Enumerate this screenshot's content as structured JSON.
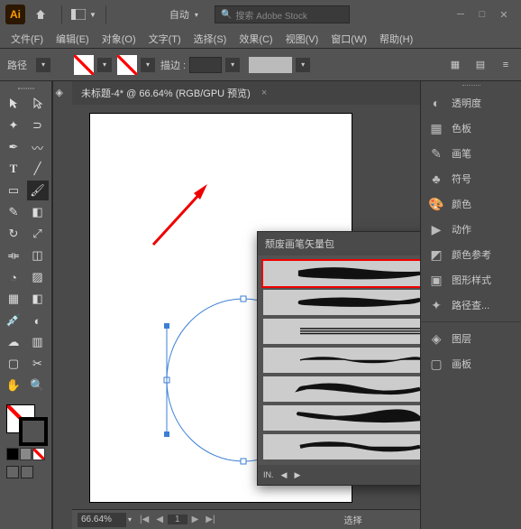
{
  "titlebar": {
    "logo": "Ai",
    "auto": "自动",
    "search_placeholder": "搜索 Adobe Stock"
  },
  "menu": [
    "文件(F)",
    "编辑(E)",
    "对象(O)",
    "文字(T)",
    "选择(S)",
    "效果(C)",
    "视图(V)",
    "窗口(W)",
    "帮助(H)"
  ],
  "ctrl": {
    "label": "路径",
    "stroke_label": "描边 :"
  },
  "doc": {
    "title": "未标题-4* @ 66.64% (RGB/GPU 预览)"
  },
  "panel": {
    "title": "颓废画笔矢量包",
    "brushes": [
      "b1",
      "b2",
      "b3",
      "b4",
      "b5",
      "b6",
      "b7"
    ]
  },
  "rpanel": {
    "items": [
      {
        "icon": "◐",
        "label": "透明度"
      },
      {
        "icon": "▦",
        "label": "色板"
      },
      {
        "icon": "✎",
        "label": "画笔"
      },
      {
        "icon": "♣",
        "label": "符号"
      },
      {
        "icon": "🎨",
        "label": "颜色"
      },
      {
        "icon": "▶",
        "label": "动作"
      },
      {
        "icon": "◩",
        "label": "颜色参考"
      },
      {
        "icon": "▣",
        "label": "图形样式"
      },
      {
        "icon": "✦",
        "label": "路径查..."
      }
    ],
    "items2": [
      {
        "icon": "◈",
        "label": "图层"
      },
      {
        "icon": "▢",
        "label": "画板"
      }
    ]
  },
  "status": {
    "zoom": "66.64%",
    "nav": "1",
    "sel": "选择"
  }
}
